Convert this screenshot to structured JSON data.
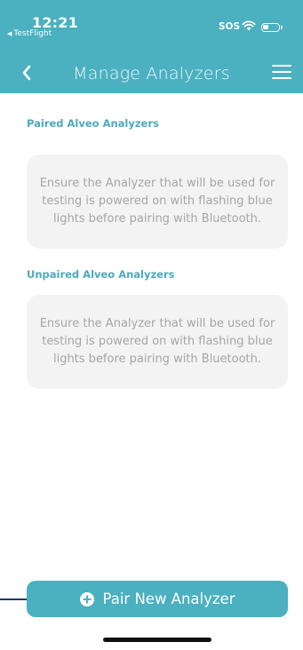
{
  "status_bar": {
    "time": "12:21",
    "back_app": "TestFlight",
    "back_arrow": "◀",
    "carrier_text": "SOS",
    "wifi_icon": "wifi-icon",
    "battery_icon": "battery-icon"
  },
  "nav": {
    "title": "Manage Analyzers",
    "back_icon": "chevron-left-icon",
    "menu_icon": "hamburger-menu-icon"
  },
  "sections": [
    {
      "title": "Paired Alveo Analyzers",
      "message": "Ensure the Analyzer that will be used for testing is powered on with flashing blue lights before pairing with Bluetooth."
    },
    {
      "title": "Unpaired Alveo Analyzers",
      "message": "Ensure the Analyzer that will be used for testing is powered on with flashing blue lights before pairing with Bluetooth."
    }
  ],
  "pair_button": {
    "label": "Pair New Analyzer",
    "icon": "plus-circle-icon"
  },
  "colors": {
    "accent": "#4bb0c0",
    "section_title": "#4ba9be",
    "box_bg": "#f3f3f3",
    "box_text": "#a6a6a6"
  }
}
